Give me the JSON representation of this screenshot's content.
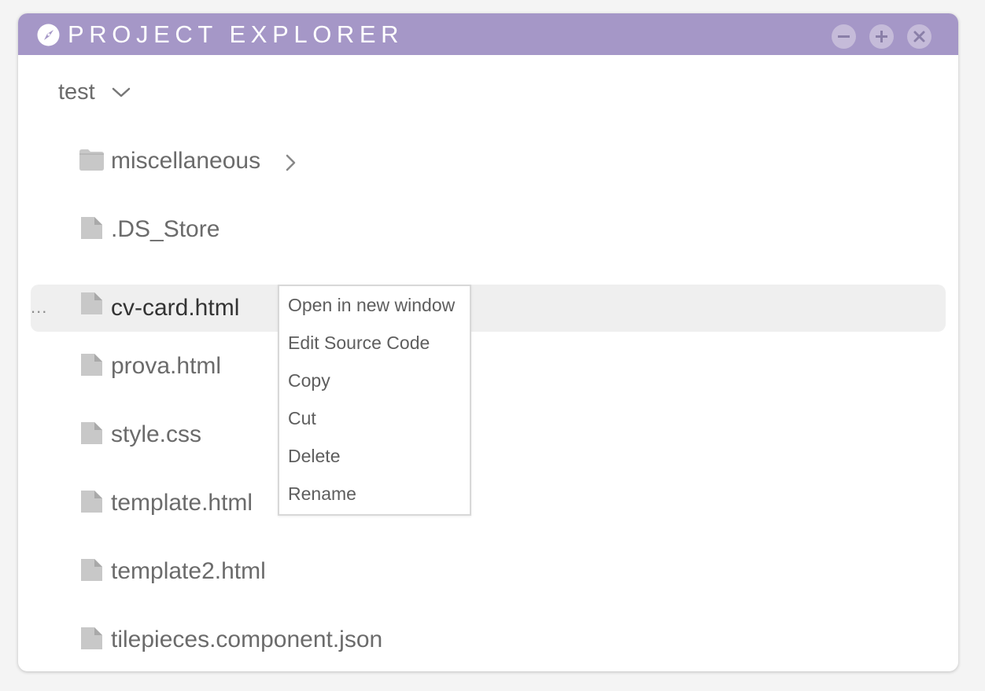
{
  "window": {
    "title": "PROJECT EXPLORER",
    "titlebar_color": "#a597c7",
    "controls": [
      "minimize-icon",
      "maximize-icon",
      "close-icon"
    ]
  },
  "tree": {
    "root": {
      "label": "test",
      "expanded": true
    },
    "items": [
      {
        "label": "miscellaneous",
        "type": "folder",
        "expandable": true
      },
      {
        "label": ".DS_Store",
        "type": "file"
      },
      {
        "label": "cv-card.html",
        "type": "file",
        "selected": true,
        "more_indicator": "..."
      },
      {
        "label": "prova.html",
        "type": "file"
      },
      {
        "label": "style.css",
        "type": "file"
      },
      {
        "label": "template.html",
        "type": "file"
      },
      {
        "label": "template2.html",
        "type": "file"
      },
      {
        "label": "tilepieces.component.json",
        "type": "file"
      }
    ]
  },
  "context_menu": {
    "items": [
      {
        "label": "Open in new window"
      },
      {
        "label": "Edit Source Code"
      },
      {
        "label": "Copy"
      },
      {
        "label": "Cut"
      },
      {
        "label": "Delete"
      },
      {
        "label": "Rename"
      }
    ]
  }
}
